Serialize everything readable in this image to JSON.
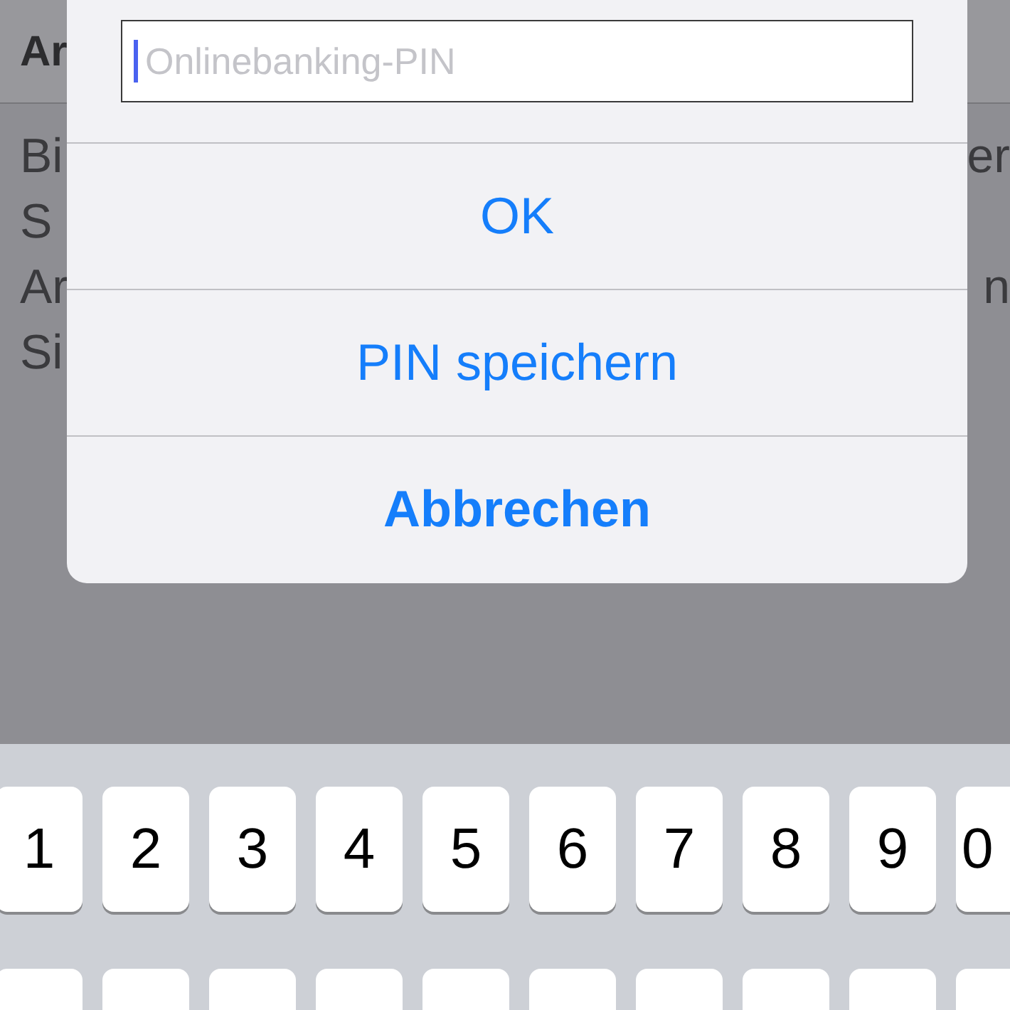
{
  "background": {
    "header_title": "Ar",
    "lines": [
      {
        "left": "Bi",
        "right": "er"
      },
      {
        "left": "S"
      },
      {
        "left": "Ar",
        "right": "n"
      },
      {
        "left": "Si"
      }
    ]
  },
  "alert": {
    "field": {
      "placeholder": "Onlinebanking-PIN"
    },
    "buttons": [
      {
        "label": "OK",
        "kind": "default"
      },
      {
        "label": "PIN speichern",
        "kind": "default"
      },
      {
        "label": "Abbrechen",
        "kind": "cancel"
      }
    ]
  },
  "keyboard": {
    "number_keys": [
      "1",
      "2",
      "3",
      "4",
      "5",
      "6",
      "7",
      "8",
      "9",
      "0"
    ]
  }
}
